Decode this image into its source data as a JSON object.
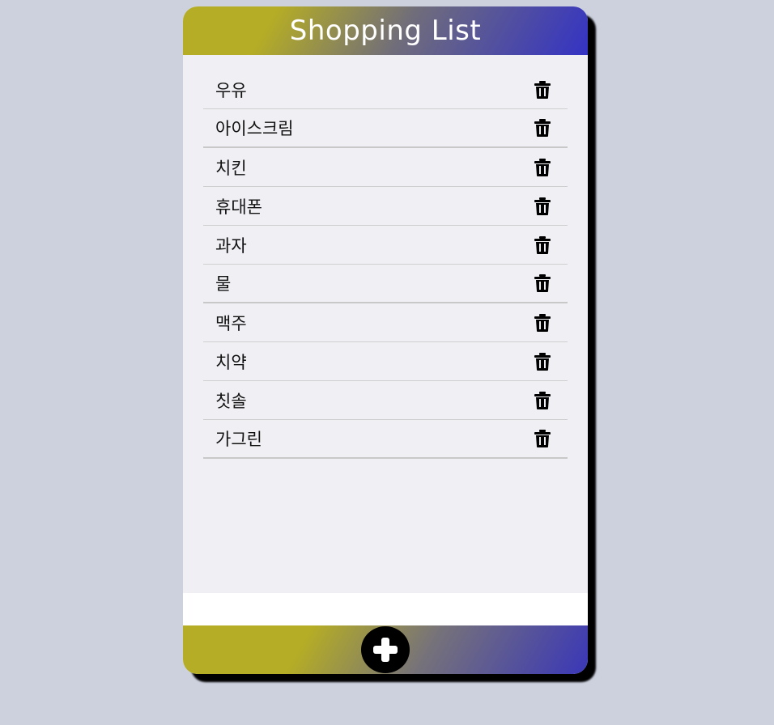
{
  "header": {
    "title": "Shopping List"
  },
  "items": [
    {
      "label": "우유"
    },
    {
      "label": "아이스크림"
    },
    {
      "label": "치킨"
    },
    {
      "label": "휴대폰"
    },
    {
      "label": "과자"
    },
    {
      "label": "물"
    },
    {
      "label": "맥주"
    },
    {
      "label": "치약"
    },
    {
      "label": "칫솔"
    },
    {
      "label": "가그린"
    }
  ],
  "icons": {
    "delete": "trash-icon",
    "add": "plus-icon"
  },
  "colors": {
    "background": "#cdd1de",
    "gradient_start": "#b5ad25",
    "gradient_end": "#3433c4",
    "list_background": "#f0eff4"
  }
}
